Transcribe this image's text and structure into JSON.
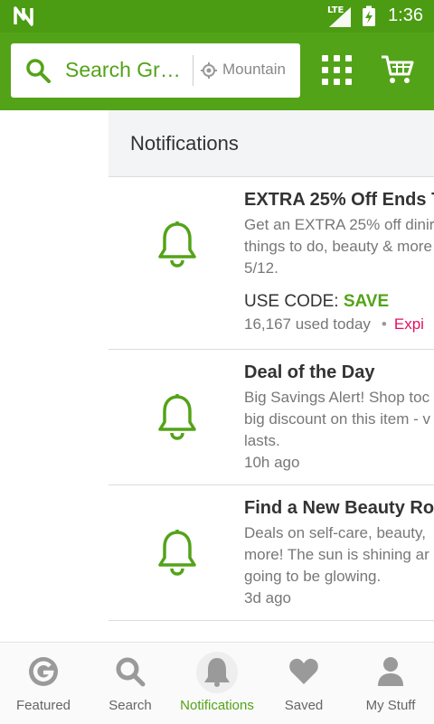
{
  "status_bar": {
    "network": "LTE",
    "time": "1:36",
    "icons": [
      "n-logo-icon",
      "signal-icon",
      "battery-icon"
    ]
  },
  "app_bar": {
    "search_placeholder": "Search Gr…",
    "location": "Mountain",
    "icons": [
      "search-icon",
      "location-icon",
      "grid-icon",
      "cart-icon"
    ]
  },
  "page": {
    "title": "Notifications"
  },
  "notifications": [
    {
      "headline": "EXTRA 25% Off Ends T",
      "body": "Get an EXTRA 25% off dinir\nthings to do, beauty & more\n5/12.",
      "code_label": "USE CODE: ",
      "code_value": "SAVE",
      "used": "16,167 used today",
      "separator": "•",
      "expires": "Expi"
    },
    {
      "headline": "Deal of the Day",
      "body": "Big Savings Alert! Shop toc\nbig discount on this item - v\nlasts.",
      "time": "10h ago"
    },
    {
      "headline": "Find a New Beauty Rou",
      "body": "Deals on self-care, beauty,\nmore! The sun is shining ar\ngoing to be glowing.",
      "time": "3d ago"
    }
  ],
  "bottom_nav": [
    {
      "label": "Featured",
      "icon": "featured-g-icon",
      "active": false
    },
    {
      "label": "Search",
      "icon": "search-icon",
      "active": false
    },
    {
      "label": "Notifications",
      "icon": "bell-icon",
      "active": true
    },
    {
      "label": "Saved",
      "icon": "heart-icon",
      "active": false
    },
    {
      "label": "My Stuff",
      "icon": "person-icon",
      "active": false
    }
  ],
  "colors": {
    "brand_green": "#53a318",
    "status_green": "#4b9b13",
    "expires_red": "#e0125f",
    "inactive_icon": "#9a9a9a"
  }
}
